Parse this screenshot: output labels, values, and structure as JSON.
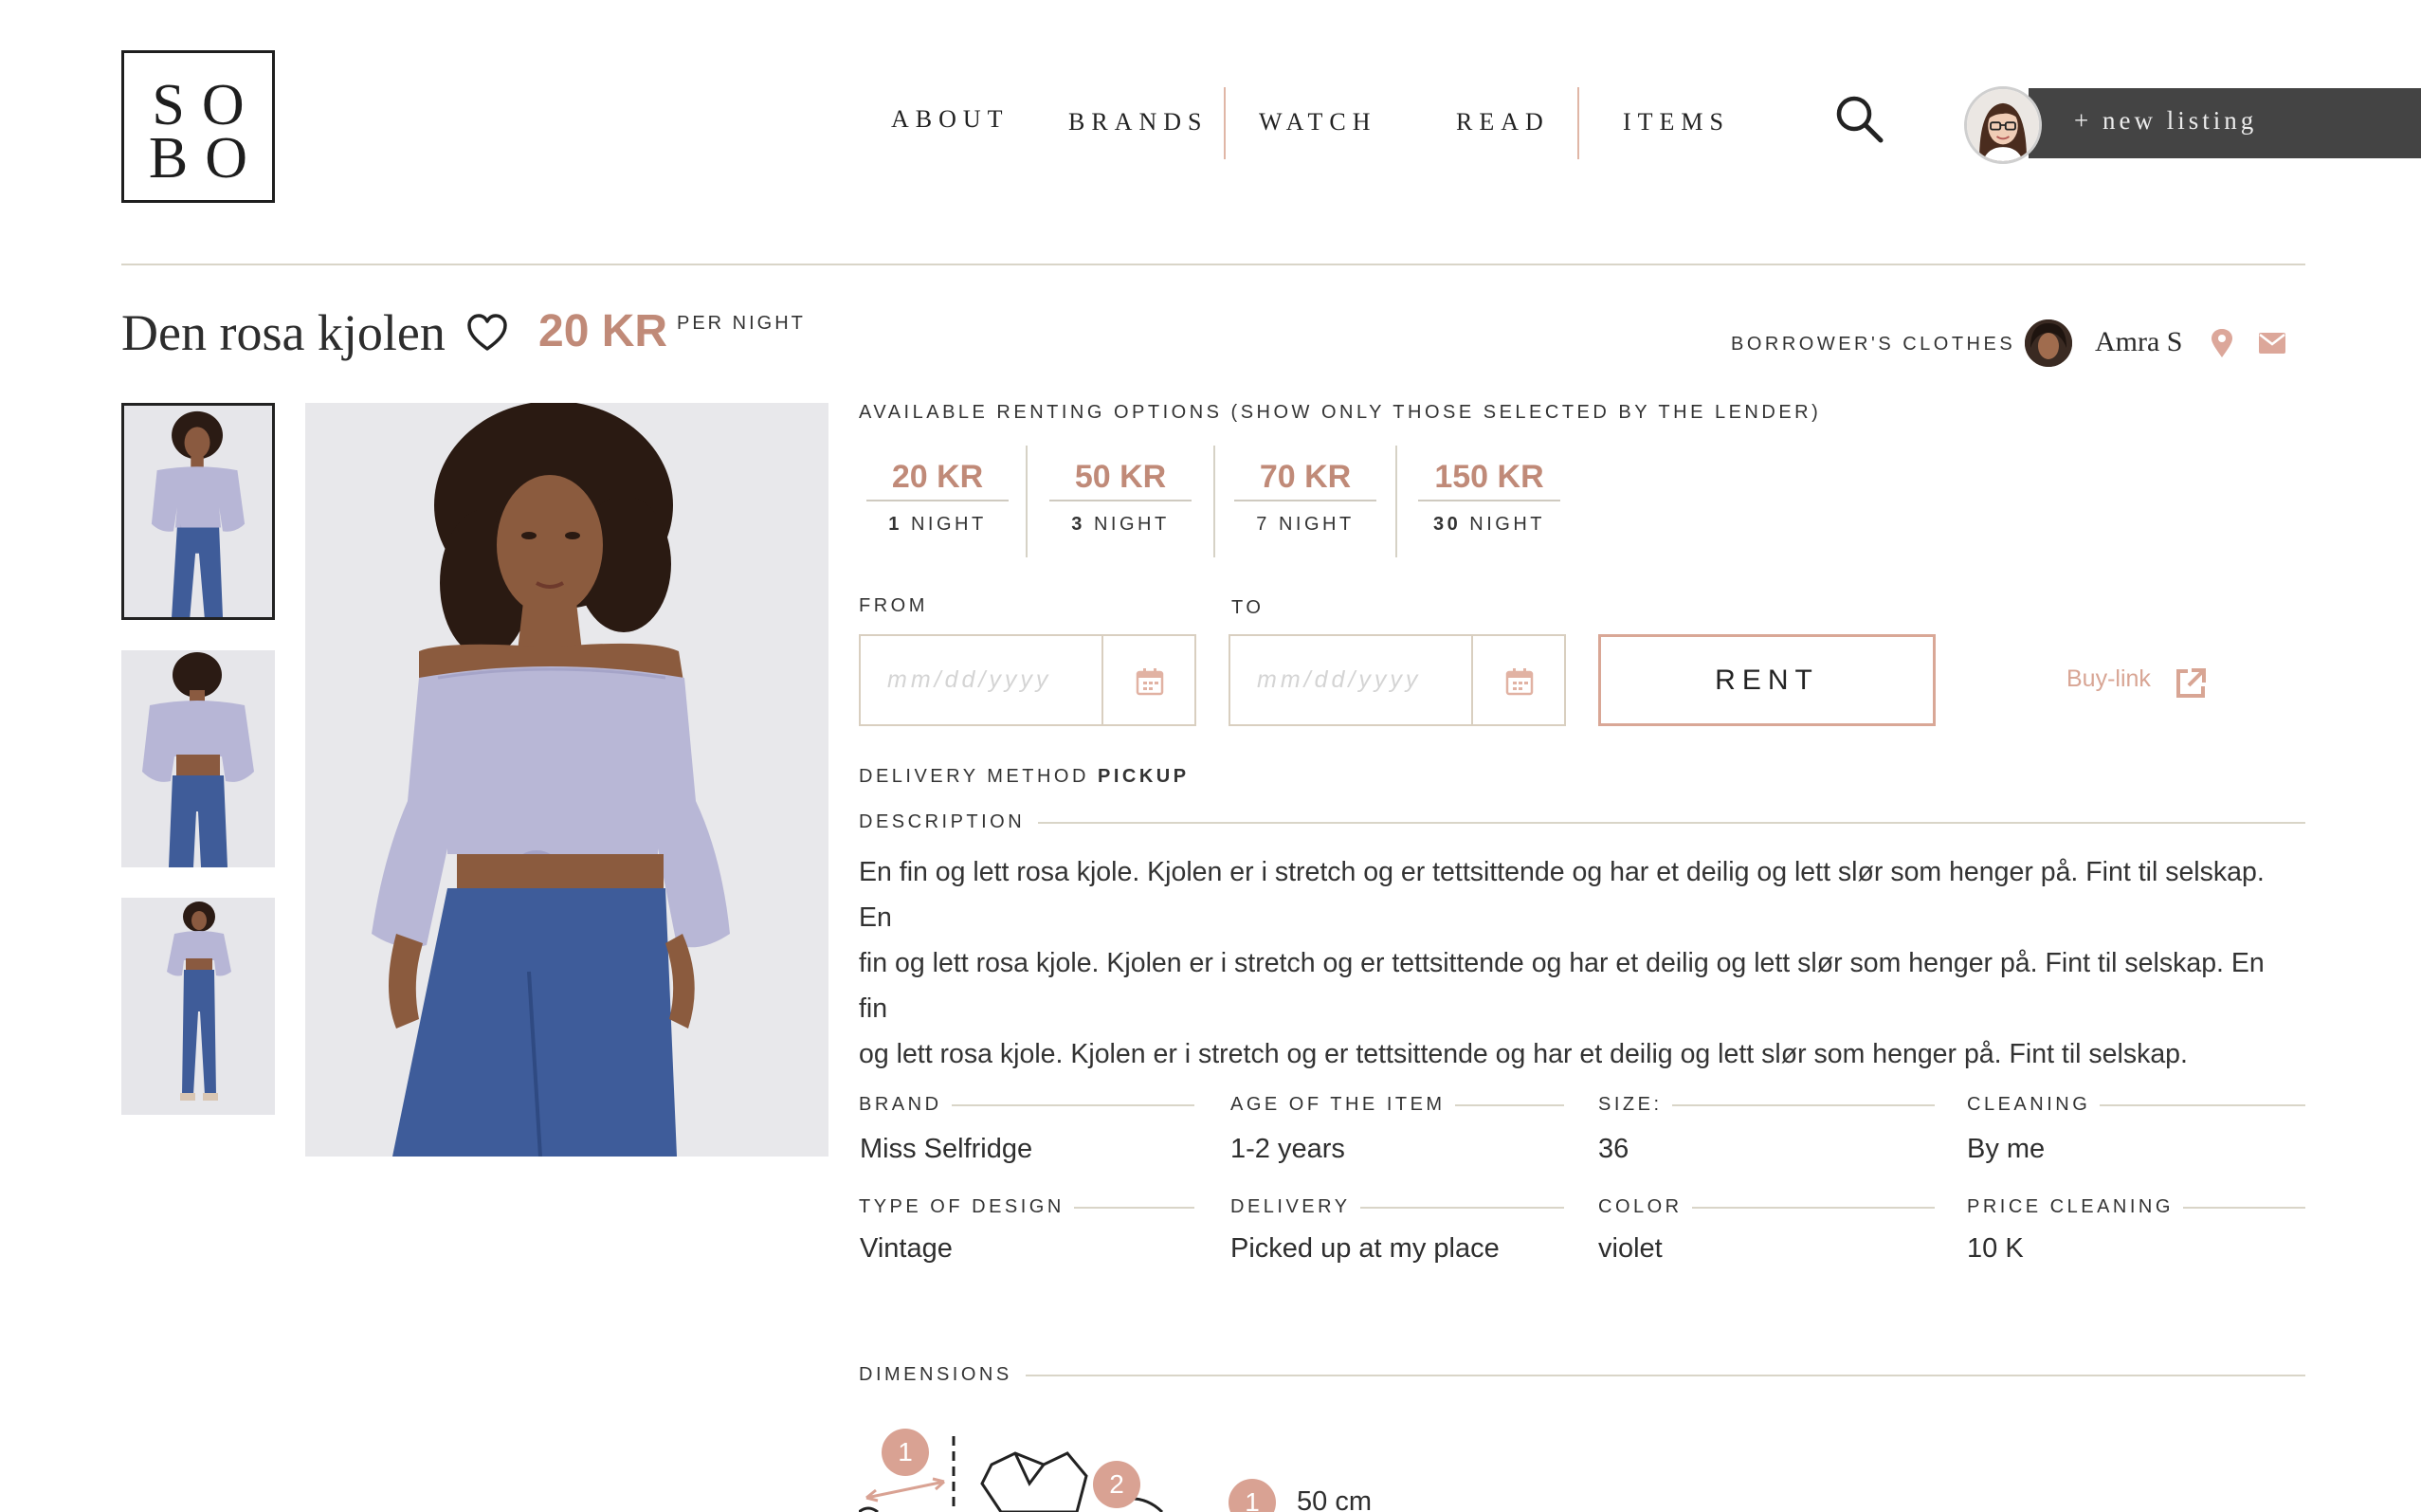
{
  "header": {
    "logo": {
      "line1": "SO",
      "line2": "BO"
    },
    "nav": [
      "ABOUT",
      "BRANDS",
      "WATCH",
      "READ",
      "ITEMS"
    ],
    "new_listing": "+ new listing",
    "icons": {
      "search": "search-icon",
      "avatar": "user-avatar"
    }
  },
  "product": {
    "title": "Den rosa kjolen",
    "price": "20 KR",
    "price_unit": "PER NIGHT",
    "owner_label": "BORROWER'S CLOTHES",
    "owner_name": "Amra S"
  },
  "renting": {
    "heading": "AVAILABLE RENTING OPTIONS (SHOW ONLY THOSE SELECTED BY THE LENDER)",
    "options": [
      {
        "price": "20 KR",
        "count": "1",
        "unit": "NIGHT",
        "count_bold": true
      },
      {
        "price": "50 KR",
        "count": "3",
        "unit": "NIGHT",
        "count_bold": true
      },
      {
        "price": "70 KR",
        "count": "7",
        "unit": "NIGHT",
        "count_bold": false
      },
      {
        "price": "150 KR",
        "count": "30",
        "unit": "NIGHT",
        "count_bold": true
      }
    ],
    "from_label": "FROM",
    "to_label": "TO",
    "date_placeholder": "mm/dd/yyyy",
    "rent_label": "RENT",
    "buy_link": "Buy-link"
  },
  "delivery": {
    "label": "DELIVERY METHOD",
    "value": "PICKUP"
  },
  "description": {
    "title": "DESCRIPTION",
    "lines": [
      "En fin og lett rosa kjole. Kjolen er i stretch og er tettsittende og har et deilig og lett slør som henger på. Fint til selskap. En",
      "fin og lett rosa kjole. Kjolen er i stretch og er tettsittende og har et deilig og lett slør som henger på. Fint til selskap. En fin",
      "og lett rosa kjole. Kjolen er i stretch og er tettsittende og har et deilig og lett slør som henger på. Fint til selskap."
    ]
  },
  "attributes": [
    {
      "label": "BRAND",
      "value": "Miss Selfridge"
    },
    {
      "label": "AGE OF THE ITEM",
      "value": "1-2 years"
    },
    {
      "label": "SIZE:",
      "value": "36"
    },
    {
      "label": "CLEANING",
      "value": "By me"
    },
    {
      "label": "TYPE OF DESIGN",
      "value": "Vintage"
    },
    {
      "label": "DELIVERY",
      "value": "Picked up at my place"
    },
    {
      "label": "COLOR",
      "value": "violet"
    },
    {
      "label": "PRICE CLEANING",
      "value": "10 K"
    }
  ],
  "dimensions": {
    "title": "DIMENSIONS",
    "markers": [
      "1",
      "2"
    ],
    "legend": [
      {
        "marker": "1",
        "value": "50 cm"
      }
    ]
  },
  "colors": {
    "accent": "#c08a78",
    "accent_light": "#d9a796",
    "dark_bar": "#444444",
    "rule": "#d9d5c8"
  }
}
